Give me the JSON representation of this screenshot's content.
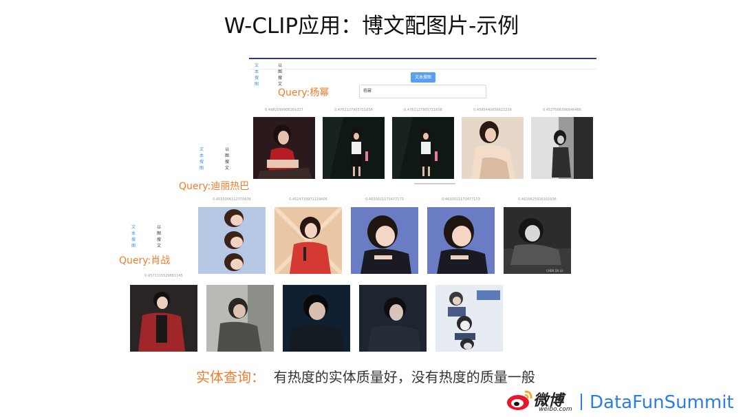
{
  "slide": {
    "title": "W-CLIP应用：博文配图片-示例"
  },
  "tabs": {
    "text_search": "文本搜图",
    "image_search": "以图搜文"
  },
  "search_button": "文本搜图",
  "input_value": "杨幂",
  "queries": [
    {
      "label": "Query:杨幂",
      "scores": [
        "0.4982099906261027",
        "0.4762127905711656",
        "0.4762127905711656",
        "0.4585440656621216",
        "0.4527006396646466"
      ]
    },
    {
      "label": "Query:迪丽热巴",
      "scores": [
        "0.4535006112370636",
        "0.4524733971119406",
        "0.4630021173477173",
        "0.4630021173477173",
        "0.4626625936161606"
      ]
    },
    {
      "label": "Query:肖战",
      "scores": [
        "0.4571315529861145"
      ]
    }
  ],
  "photo_caption": "CHEN DA LU",
  "footer": {
    "highlight": "实体查询",
    "colon": "：",
    "text": "有热度的实体质量好，没有热度的质量一般"
  },
  "logo": {
    "weibo_cn": "微博",
    "weibo_en": "weibo.com",
    "brand": "DataFunSummit"
  },
  "colors": {
    "accent_orange": "#ef7d2e",
    "brand_blue": "#2a7de1",
    "tab_active": "#3d8fe8"
  }
}
